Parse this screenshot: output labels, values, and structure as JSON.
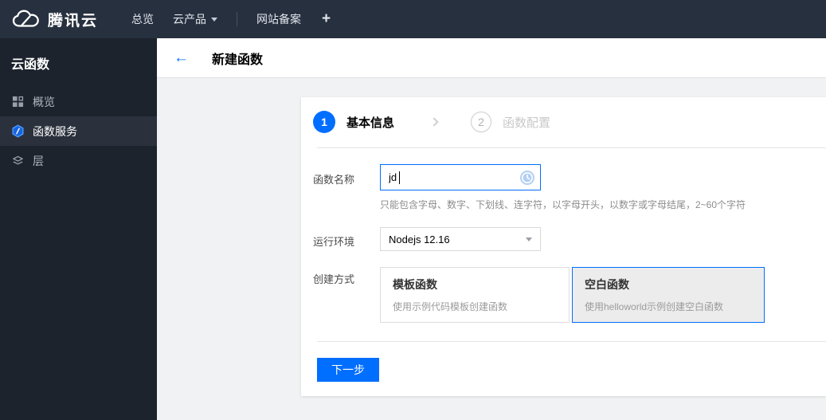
{
  "topbar": {
    "brand": "腾讯云",
    "items": [
      {
        "label": "总览"
      },
      {
        "label": "云产品",
        "has_caret": true
      },
      {
        "label": "网站备案"
      },
      {
        "label": "+"
      }
    ]
  },
  "sidebar": {
    "title": "云函数",
    "items": [
      {
        "label": "概览",
        "icon": "grid-icon",
        "active": false
      },
      {
        "label": "函数服务",
        "icon": "scf-hexagon-icon",
        "active": true
      },
      {
        "label": "层",
        "icon": "layers-icon",
        "active": false
      }
    ]
  },
  "header": {
    "back_icon": "←",
    "title": "新建函数"
  },
  "wizard": {
    "steps": [
      {
        "number": "1",
        "label": "基本信息",
        "state": "active"
      },
      {
        "number": "2",
        "label": "函数配置",
        "state": "pending"
      }
    ]
  },
  "form": {
    "name": {
      "label": "函数名称",
      "value": "jd",
      "trailing_icon": "clock-history-icon",
      "helper": "只能包含字母、数字、下划线、连字符，以字母开头，以数字或字母结尾，2~60个字符"
    },
    "runtime": {
      "label": "运行环境",
      "value": "Nodejs 12.16"
    },
    "creation": {
      "label": "创建方式",
      "options": [
        {
          "title": "模板函数",
          "desc": "使用示例代码模板创建函数",
          "selected": false
        },
        {
          "title": "空白函数",
          "desc": "使用helloworld示例创建空白函数",
          "selected": true
        }
      ]
    },
    "next_button": "下一步"
  },
  "colors": {
    "accent": "#006eff",
    "topbar_bg": "#27303f",
    "sidebar_bg": "#1d232d",
    "selected_card_bg": "#ececed"
  }
}
